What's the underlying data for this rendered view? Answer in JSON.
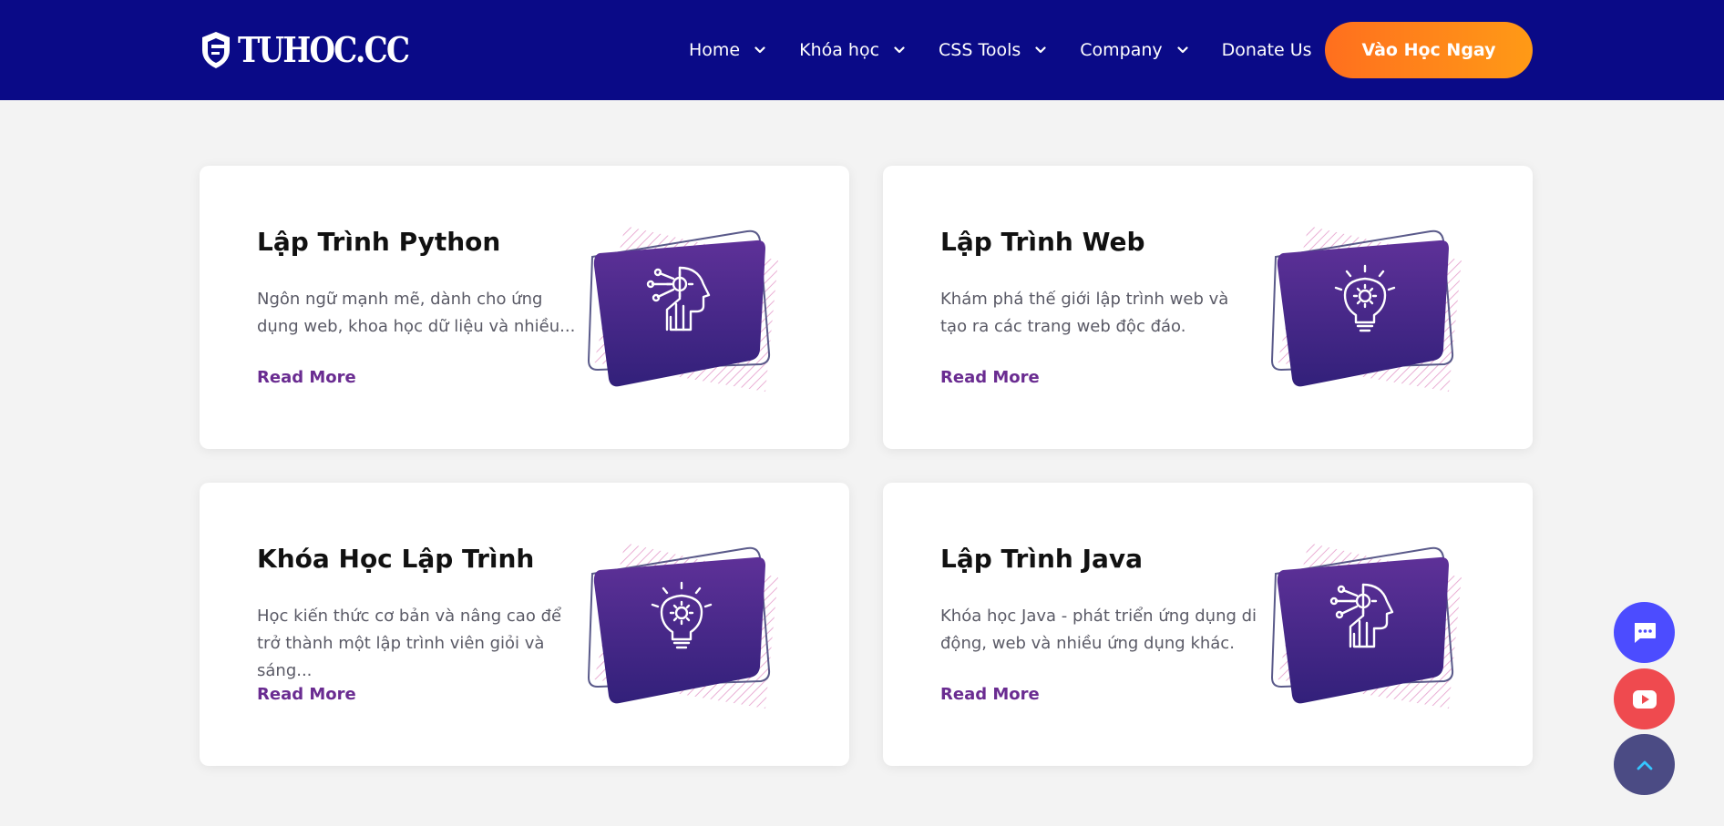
{
  "header": {
    "logo_text": "TUHOC.CC",
    "nav": [
      {
        "label": "Home",
        "icon": "chevron-down-icon"
      },
      {
        "label": "Khóa học",
        "icon": "chevron-down-icon"
      },
      {
        "label": "CSS Tools",
        "icon": "chevron-down-icon"
      },
      {
        "label": "Company",
        "icon": "chevron-down-icon"
      },
      {
        "label": "Donate Us"
      }
    ],
    "cta_label": "Vào Học Ngay"
  },
  "cards": [
    {
      "title": "Lập Trình Python",
      "description": "Ngôn ngữ mạnh mẽ, dành cho ứng dụng web, khoa học dữ liệu và nhiều...",
      "link": "Read More",
      "icon": "ai-head-icon"
    },
    {
      "title": "Lập Trình Web",
      "description": "Khám phá thế giới lập trình web và tạo ra các trang web độc đáo.",
      "link": "Read More",
      "icon": "lightbulb-gear-icon"
    },
    {
      "title": "Khóa Học Lập Trình",
      "description": "Học kiến thức cơ bản và nâng cao để trở thành một lập trình viên giỏi và sáng...",
      "link": "Read More",
      "icon": "lightbulb-gear-icon"
    },
    {
      "title": "Lập Trình Java",
      "description": "Khóa học Java - phát triển ứng dụng di động, web và nhiều ứng dụng khác.",
      "link": "Read More",
      "icon": "ai-head-icon"
    }
  ],
  "floating_buttons": [
    {
      "name": "chat-icon",
      "color": "#4c4cff"
    },
    {
      "name": "youtube-icon",
      "color": "#ef4a4f"
    },
    {
      "name": "chevron-up-icon",
      "color": "#4b4b84"
    }
  ],
  "colors": {
    "nav_bg": "#0a0a87",
    "cta_gradient_start": "#ff6f1e",
    "cta_gradient_end": "#ff9a16",
    "link": "#6a2c91",
    "card_art": "#4d2a8e"
  }
}
